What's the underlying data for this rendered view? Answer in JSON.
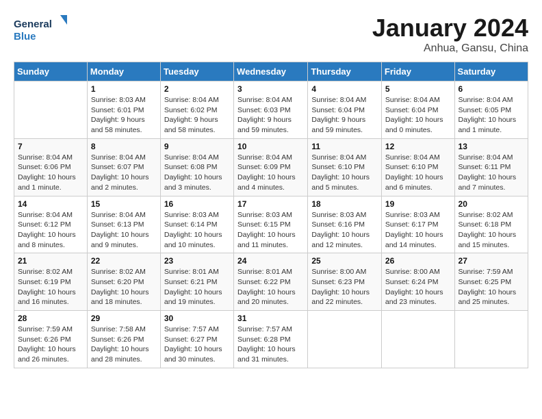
{
  "header": {
    "logo_general": "General",
    "logo_blue": "Blue",
    "main_title": "January 2024",
    "subtitle": "Anhua, Gansu, China"
  },
  "calendar": {
    "days_of_week": [
      "Sunday",
      "Monday",
      "Tuesday",
      "Wednesday",
      "Thursday",
      "Friday",
      "Saturday"
    ],
    "weeks": [
      [
        {
          "num": "",
          "sunrise": "",
          "sunset": "",
          "daylight": ""
        },
        {
          "num": "1",
          "sunrise": "Sunrise: 8:03 AM",
          "sunset": "Sunset: 6:01 PM",
          "daylight": "Daylight: 9 hours and 58 minutes."
        },
        {
          "num": "2",
          "sunrise": "Sunrise: 8:04 AM",
          "sunset": "Sunset: 6:02 PM",
          "daylight": "Daylight: 9 hours and 58 minutes."
        },
        {
          "num": "3",
          "sunrise": "Sunrise: 8:04 AM",
          "sunset": "Sunset: 6:03 PM",
          "daylight": "Daylight: 9 hours and 59 minutes."
        },
        {
          "num": "4",
          "sunrise": "Sunrise: 8:04 AM",
          "sunset": "Sunset: 6:04 PM",
          "daylight": "Daylight: 9 hours and 59 minutes."
        },
        {
          "num": "5",
          "sunrise": "Sunrise: 8:04 AM",
          "sunset": "Sunset: 6:04 PM",
          "daylight": "Daylight: 10 hours and 0 minutes."
        },
        {
          "num": "6",
          "sunrise": "Sunrise: 8:04 AM",
          "sunset": "Sunset: 6:05 PM",
          "daylight": "Daylight: 10 hours and 1 minute."
        }
      ],
      [
        {
          "num": "7",
          "sunrise": "Sunrise: 8:04 AM",
          "sunset": "Sunset: 6:06 PM",
          "daylight": "Daylight: 10 hours and 1 minute."
        },
        {
          "num": "8",
          "sunrise": "Sunrise: 8:04 AM",
          "sunset": "Sunset: 6:07 PM",
          "daylight": "Daylight: 10 hours and 2 minutes."
        },
        {
          "num": "9",
          "sunrise": "Sunrise: 8:04 AM",
          "sunset": "Sunset: 6:08 PM",
          "daylight": "Daylight: 10 hours and 3 minutes."
        },
        {
          "num": "10",
          "sunrise": "Sunrise: 8:04 AM",
          "sunset": "Sunset: 6:09 PM",
          "daylight": "Daylight: 10 hours and 4 minutes."
        },
        {
          "num": "11",
          "sunrise": "Sunrise: 8:04 AM",
          "sunset": "Sunset: 6:10 PM",
          "daylight": "Daylight: 10 hours and 5 minutes."
        },
        {
          "num": "12",
          "sunrise": "Sunrise: 8:04 AM",
          "sunset": "Sunset: 6:10 PM",
          "daylight": "Daylight: 10 hours and 6 minutes."
        },
        {
          "num": "13",
          "sunrise": "Sunrise: 8:04 AM",
          "sunset": "Sunset: 6:11 PM",
          "daylight": "Daylight: 10 hours and 7 minutes."
        }
      ],
      [
        {
          "num": "14",
          "sunrise": "Sunrise: 8:04 AM",
          "sunset": "Sunset: 6:12 PM",
          "daylight": "Daylight: 10 hours and 8 minutes."
        },
        {
          "num": "15",
          "sunrise": "Sunrise: 8:04 AM",
          "sunset": "Sunset: 6:13 PM",
          "daylight": "Daylight: 10 hours and 9 minutes."
        },
        {
          "num": "16",
          "sunrise": "Sunrise: 8:03 AM",
          "sunset": "Sunset: 6:14 PM",
          "daylight": "Daylight: 10 hours and 10 minutes."
        },
        {
          "num": "17",
          "sunrise": "Sunrise: 8:03 AM",
          "sunset": "Sunset: 6:15 PM",
          "daylight": "Daylight: 10 hours and 11 minutes."
        },
        {
          "num": "18",
          "sunrise": "Sunrise: 8:03 AM",
          "sunset": "Sunset: 6:16 PM",
          "daylight": "Daylight: 10 hours and 12 minutes."
        },
        {
          "num": "19",
          "sunrise": "Sunrise: 8:03 AM",
          "sunset": "Sunset: 6:17 PM",
          "daylight": "Daylight: 10 hours and 14 minutes."
        },
        {
          "num": "20",
          "sunrise": "Sunrise: 8:02 AM",
          "sunset": "Sunset: 6:18 PM",
          "daylight": "Daylight: 10 hours and 15 minutes."
        }
      ],
      [
        {
          "num": "21",
          "sunrise": "Sunrise: 8:02 AM",
          "sunset": "Sunset: 6:19 PM",
          "daylight": "Daylight: 10 hours and 16 minutes."
        },
        {
          "num": "22",
          "sunrise": "Sunrise: 8:02 AM",
          "sunset": "Sunset: 6:20 PM",
          "daylight": "Daylight: 10 hours and 18 minutes."
        },
        {
          "num": "23",
          "sunrise": "Sunrise: 8:01 AM",
          "sunset": "Sunset: 6:21 PM",
          "daylight": "Daylight: 10 hours and 19 minutes."
        },
        {
          "num": "24",
          "sunrise": "Sunrise: 8:01 AM",
          "sunset": "Sunset: 6:22 PM",
          "daylight": "Daylight: 10 hours and 20 minutes."
        },
        {
          "num": "25",
          "sunrise": "Sunrise: 8:00 AM",
          "sunset": "Sunset: 6:23 PM",
          "daylight": "Daylight: 10 hours and 22 minutes."
        },
        {
          "num": "26",
          "sunrise": "Sunrise: 8:00 AM",
          "sunset": "Sunset: 6:24 PM",
          "daylight": "Daylight: 10 hours and 23 minutes."
        },
        {
          "num": "27",
          "sunrise": "Sunrise: 7:59 AM",
          "sunset": "Sunset: 6:25 PM",
          "daylight": "Daylight: 10 hours and 25 minutes."
        }
      ],
      [
        {
          "num": "28",
          "sunrise": "Sunrise: 7:59 AM",
          "sunset": "Sunset: 6:26 PM",
          "daylight": "Daylight: 10 hours and 26 minutes."
        },
        {
          "num": "29",
          "sunrise": "Sunrise: 7:58 AM",
          "sunset": "Sunset: 6:26 PM",
          "daylight": "Daylight: 10 hours and 28 minutes."
        },
        {
          "num": "30",
          "sunrise": "Sunrise: 7:57 AM",
          "sunset": "Sunset: 6:27 PM",
          "daylight": "Daylight: 10 hours and 30 minutes."
        },
        {
          "num": "31",
          "sunrise": "Sunrise: 7:57 AM",
          "sunset": "Sunset: 6:28 PM",
          "daylight": "Daylight: 10 hours and 31 minutes."
        },
        {
          "num": "",
          "sunrise": "",
          "sunset": "",
          "daylight": ""
        },
        {
          "num": "",
          "sunrise": "",
          "sunset": "",
          "daylight": ""
        },
        {
          "num": "",
          "sunrise": "",
          "sunset": "",
          "daylight": ""
        }
      ]
    ]
  }
}
